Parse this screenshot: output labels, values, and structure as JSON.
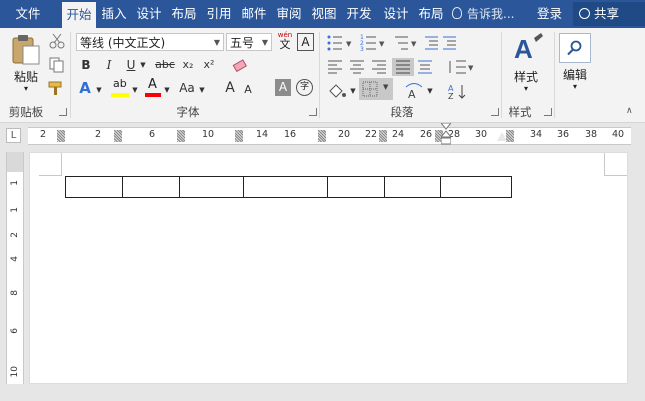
{
  "tabs": {
    "file": "文件",
    "items": [
      "开始",
      "插入",
      "设计",
      "布局",
      "引用",
      "邮件",
      "审阅",
      "视图",
      "开发",
      "设计",
      "布局"
    ],
    "tell_me": "告诉我...",
    "login": "登录",
    "share": "共享"
  },
  "clipboard": {
    "paste": "粘贴",
    "group": "剪贴板"
  },
  "font": {
    "name": "等线 (中文正文)",
    "size": "五号",
    "wen": "wén",
    "wen_char": "文",
    "boxA": "A",
    "bold": "B",
    "italic": "I",
    "underline": "U",
    "strike": "abc",
    "sub": "x₂",
    "sup": "x²",
    "highlight": "ab",
    "fontcolor": "A",
    "aa": "Aa",
    "grow": "A",
    "shrink": "A",
    "shade": "A",
    "circ": "字",
    "group": "字体"
  },
  "paragraph": {
    "group": "段落"
  },
  "styles": {
    "label": "样式",
    "group": "样式"
  },
  "editing": {
    "label": "编辑"
  },
  "ruler": {
    "numbers": [
      "2",
      "2",
      "6",
      "10",
      "14",
      "16",
      "20",
      "22",
      "24",
      "26",
      "28",
      "30",
      "34",
      "36",
      "38",
      "40"
    ]
  },
  "vruler": {
    "numbers": [
      "1",
      "1",
      "2",
      "4",
      "8",
      "6",
      "10"
    ]
  },
  "colors": {
    "accent": "#2b579a",
    "highlight": "#ffff00",
    "font_color": "#ff0000"
  }
}
